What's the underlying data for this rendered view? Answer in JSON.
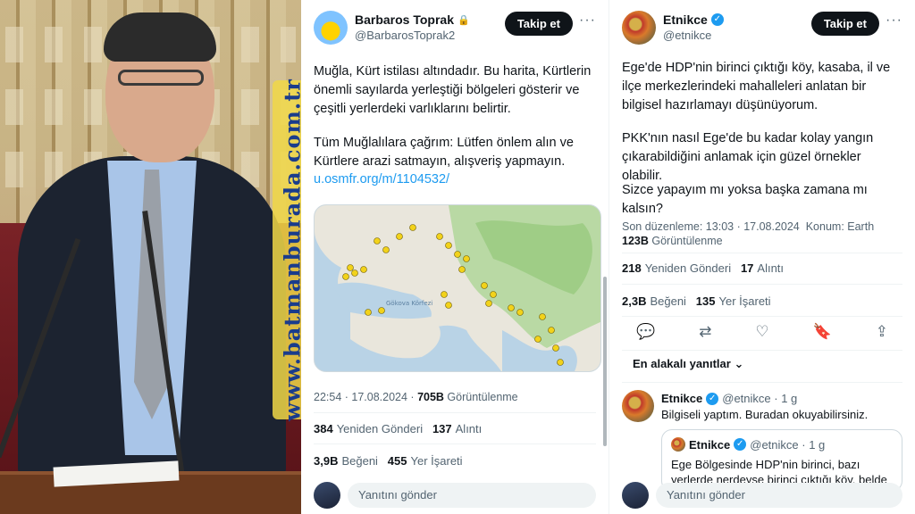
{
  "watermark": "www.batmanburada.com.tr",
  "tweet1": {
    "display_name": "Barbaros Toprak",
    "handle": "@BarbarosToprak2",
    "follow_label": "Takip et",
    "text_p1": "Muğla, Kürt istilası altındadır. Bu harita, Kürtlerin önemli sayılarda yerleştiği bölgeleri gösterir ve çeşitli yerlerdeki varlıklarını belirtir.",
    "text_p2": "Tüm Muğlalılara çağrım: Lütfen önlem alın ve Kürtlere arazi satmayın, alışveriş yapmayın.",
    "link": "u.osmfr.org/m/1104532/",
    "timestamp": "22:54 · 17.08.2024 · ",
    "views_count": "705B",
    "views_label": " Görüntülenme",
    "reposts_count": "384",
    "reposts_label": "Yeniden Gönderi",
    "quotes_count": "137",
    "quotes_label": "Alıntı",
    "likes_count": "3,9B",
    "likes_label": "Beğeni",
    "bookmarks_count": "455",
    "bookmarks_label": "Yer İşareti",
    "reply_placeholder": "Yanıtını gönder",
    "map_sea_label": "Gökova Körfezi"
  },
  "tweet2": {
    "display_name": "Etnikce",
    "handle": "@etnikce",
    "follow_label": "Takip et",
    "text_p1": "Ege'de HDP'nin birinci çıktığı köy, kasaba, il ve ilçe merkezlerindeki mahalleleri anlatan bir bilgisel hazırlamayı düşünüyorum.",
    "text_p2": "PKK'nın nasıl Ege'de bu kadar kolay yangın çıkarabildiğini anlamak için güzel örnekler olabilir.",
    "text_p3": "Sizce yapayım mı yoksa başka zamana mı kalsın?",
    "edited": "Son düzenleme: 13:03 · 17.08.2024",
    "location": "Konum: Earth",
    "views_count": "123B",
    "views_label": "Görüntülenme",
    "reposts_count": "218",
    "reposts_label": "Yeniden Gönderi",
    "quotes_count": "17",
    "quotes_label": "Alıntı",
    "likes_count": "2,3B",
    "likes_label": "Beğeni",
    "bookmarks_count": "135",
    "bookmarks_label": "Yer İşareti",
    "sort_label": "En alakalı yanıtlar",
    "reply": {
      "name": "Etnikce",
      "handle": "@etnikce · 1 g",
      "text": "Bilgiseli yaptım. Buradan okuyabilirsiniz.",
      "quote_name": "Etnikce",
      "quote_handle": "@etnikce · 1 g",
      "quote_text": "Ege Bölgesinde HDP'nin birinci, bazı yerlerde nerdeyse birinci çıktığı köy, belde"
    },
    "reply_placeholder": "Yanıtını gönder"
  },
  "icons": {
    "reply": "💬",
    "retweet": "⇄",
    "like": "♡",
    "bookmark": "🔖",
    "share": "⇪",
    "more": "···",
    "chevron": "⌄"
  }
}
